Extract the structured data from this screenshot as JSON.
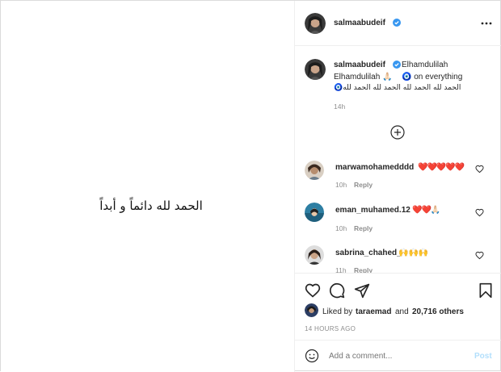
{
  "post": {
    "image_text": "الحمد لله دائماً و أبداً"
  },
  "header": {
    "username": "salmaabudeif",
    "more_icon": "more-horizontal-icon"
  },
  "caption": {
    "username": "salmaabudeif",
    "line1": "Elhamdulilah",
    "line2_a": "Elhamdulilah 🙏🏻",
    "line2_b": "🧿 on everything",
    "line3": "🧿الحمد لله الحمد لله الحمد لله الحمد لله",
    "time": "14h"
  },
  "load_more_icon": "plus-circle-icon",
  "comments": [
    {
      "username": "marwamohamedddd",
      "text": "❤️❤️❤️❤️❤️",
      "time": "10h",
      "reply": "Reply"
    },
    {
      "username": "eman_muhamed.12",
      "text": "❤️❤️🙏🏻",
      "time": "10h",
      "reply": "Reply"
    },
    {
      "username": "sabrina_chahed_",
      "text": "🙌🙌🙌",
      "time": "11h",
      "reply": "Reply"
    }
  ],
  "likes": {
    "prefix": "Liked by",
    "user": "taraemad",
    "joiner": "and",
    "count": "20,716 others"
  },
  "timestamp": "14 HOURS AGO",
  "add_comment": {
    "placeholder": "Add a comment...",
    "post_label": "Post"
  },
  "colors": {
    "verified": "#3897f0",
    "post_button": "#b2dffc",
    "heart": "#ed4956"
  }
}
